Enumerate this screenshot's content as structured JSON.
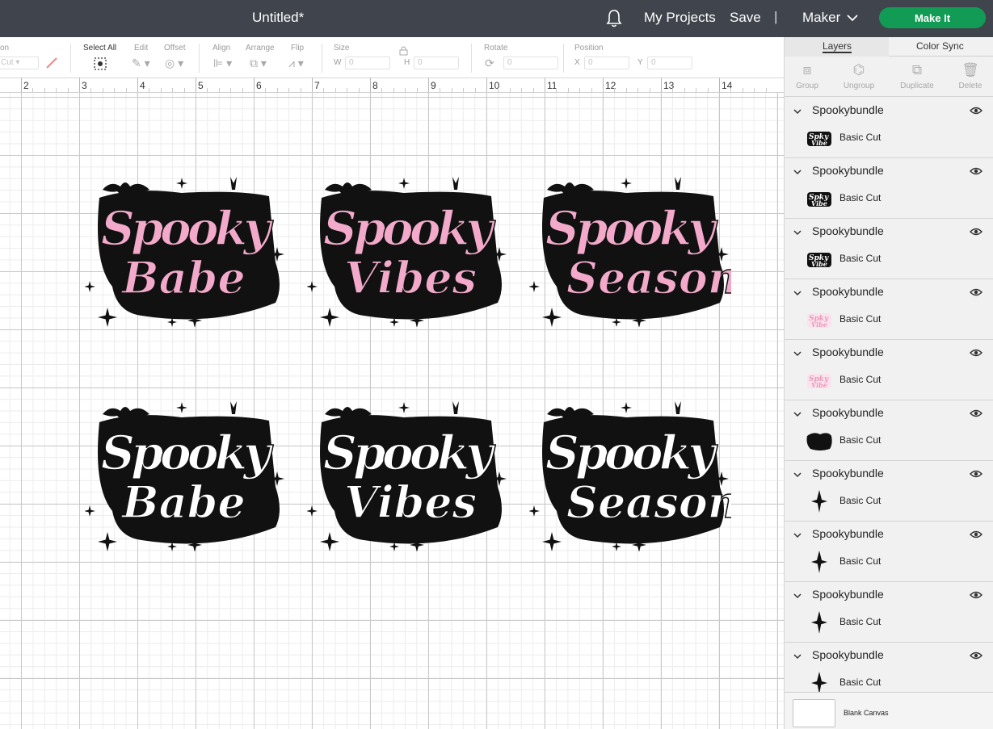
{
  "topbar": {
    "title": "Untitled*",
    "my_projects": "My Projects",
    "save": "Save",
    "separator": "|",
    "machine": "Maker",
    "make_it": "Make It",
    "accent": "#129b55"
  },
  "toolbar": {
    "operation_label": "on",
    "operation_value": "Cut",
    "select_all": "Select All",
    "edit": "Edit",
    "offset": "Offset",
    "align": "Align",
    "arrange": "Arrange",
    "flip": "Flip",
    "size": "Size",
    "w_label": "W",
    "w_value": "0",
    "h_label": "H",
    "h_value": "0",
    "rotate": "Rotate",
    "rotate_value": "0",
    "position": "Position",
    "x_label": "X",
    "x_value": "0",
    "y_label": "Y",
    "y_value": "0"
  },
  "ruler": {
    "labels": [
      "2",
      "3",
      "4",
      "5",
      "6",
      "7",
      "8",
      "9",
      "10",
      "11",
      "12",
      "13",
      "14"
    ]
  },
  "designs": [
    {
      "name": "spooky-babe-pink",
      "line1": "Spooky",
      "line2": "Babe",
      "fill": "#f2a9ca"
    },
    {
      "name": "spooky-vibes-pink",
      "line1": "Spooky",
      "line2": "Vibes",
      "fill": "#f2a9ca"
    },
    {
      "name": "spooky-season-pink",
      "line1": "Spooky",
      "line2": "Season",
      "fill": "#f2a9ca"
    },
    {
      "name": "spooky-babe-white",
      "line1": "Spooky",
      "line2": "Babe",
      "fill": "#ffffff"
    },
    {
      "name": "spooky-vibes-white",
      "line1": "Spooky",
      "line2": "Vibes",
      "fill": "#ffffff"
    },
    {
      "name": "spooky-season-white",
      "line1": "Spooky",
      "line2": "Season",
      "fill": "#ffffff"
    }
  ],
  "panel": {
    "tabs": [
      "Layers",
      "Color Sync"
    ],
    "actions": [
      "Group",
      "Ungroup",
      "Duplicate",
      "Delete"
    ],
    "layers": [
      {
        "name": "Spookybundle",
        "cut": "Basic Cut",
        "thumb": "text-black"
      },
      {
        "name": "Spookybundle",
        "cut": "Basic Cut",
        "thumb": "text-black"
      },
      {
        "name": "Spookybundle",
        "cut": "Basic Cut",
        "thumb": "text-black"
      },
      {
        "name": "Spookybundle",
        "cut": "Basic Cut",
        "thumb": "text-pink"
      },
      {
        "name": "Spookybundle",
        "cut": "Basic Cut",
        "thumb": "text-pink"
      },
      {
        "name": "Spookybundle",
        "cut": "Basic Cut",
        "thumb": "blob-black"
      },
      {
        "name": "Spookybundle",
        "cut": "Basic Cut",
        "thumb": "sparkle-black"
      },
      {
        "name": "Spookybundle",
        "cut": "Basic Cut",
        "thumb": "sparkle-black"
      },
      {
        "name": "Spookybundle",
        "cut": "Basic Cut",
        "thumb": "sparkle-black"
      },
      {
        "name": "Spookybundle",
        "cut": "Basic Cut",
        "thumb": "sparkle-black"
      }
    ],
    "blank_canvas": "Blank Canvas"
  }
}
